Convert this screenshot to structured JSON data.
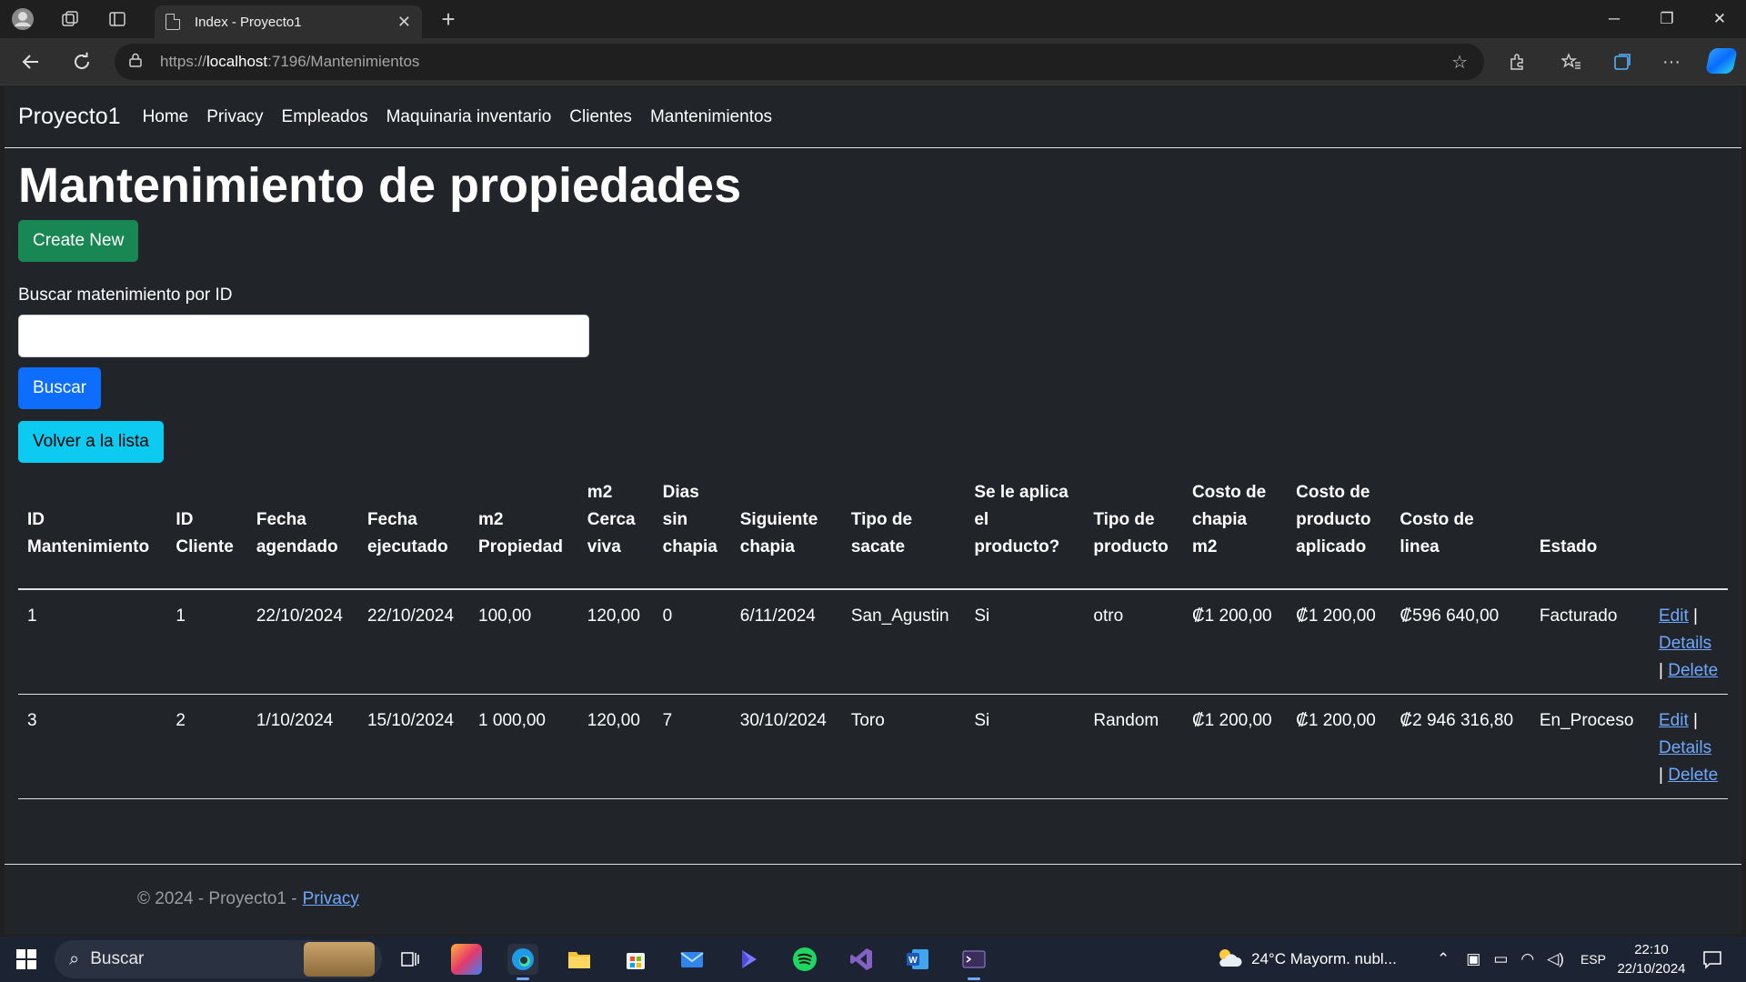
{
  "browser": {
    "tab_title": "Index - Proyecto1",
    "url_proto": "https://",
    "url_host": "localhost",
    "url_path": ":7196/Mantenimientos",
    "new_tab_label": "+"
  },
  "navbar": {
    "brand": "Proyecto1",
    "links": [
      "Home",
      "Privacy",
      "Empleados",
      "Maquinaria inventario",
      "Clientes",
      "Mantenimientos"
    ]
  },
  "main": {
    "title": "Mantenimiento de propiedades",
    "create_label": "Create New",
    "search_label": "Buscar matenimiento por ID",
    "search_value": "",
    "search_button": "Buscar",
    "back_button": "Volver a la lista"
  },
  "table": {
    "headers": [
      [
        "ID",
        "Mantenimiento"
      ],
      [
        "ID",
        "Cliente"
      ],
      [
        "Fecha",
        "agendado"
      ],
      [
        "Fecha",
        "ejecutado"
      ],
      [
        "m2",
        "Propiedad"
      ],
      [
        "m2",
        "Cerca",
        "viva"
      ],
      [
        "Dias",
        "sin",
        "chapia"
      ],
      [
        "Siguiente",
        "chapia"
      ],
      [
        "Tipo de",
        "sacate"
      ],
      [
        "Se le aplica",
        "el",
        "producto?"
      ],
      [
        "Tipo de",
        "producto"
      ],
      [
        "Costo de",
        "chapia",
        "m2"
      ],
      [
        "Costo de",
        "producto",
        "aplicado"
      ],
      [
        "Costo de",
        "linea"
      ],
      [
        "Estado"
      ],
      [
        ""
      ]
    ],
    "rows": [
      {
        "cells": [
          "1",
          "1",
          "22/10/2024",
          "22/10/2024",
          "100,00",
          "120,00",
          "0",
          "6/11/2024",
          "San_Agustin",
          "Si",
          "otro",
          "₡1 200,00",
          "₡1 200,00",
          "₡596 640,00",
          "Facturado"
        ],
        "edit": "Edit",
        "details": "Details",
        "delete": "Delete"
      },
      {
        "cells": [
          "3",
          "2",
          "1/10/2024",
          "15/10/2024",
          "1 000,00",
          "120,00",
          "7",
          "30/10/2024",
          "Toro",
          "Si",
          "Random",
          "₡1 200,00",
          "₡1 200,00",
          "₡2 946 316,80",
          "En_Proceso"
        ],
        "edit": "Edit",
        "details": "Details",
        "delete": "Delete"
      }
    ],
    "separator": "|"
  },
  "footer": {
    "text": "© 2024 - Proyecto1 -",
    "link": "Privacy"
  },
  "taskbar": {
    "search_placeholder": "Buscar",
    "weather": "24°C  Mayorm. nubl...",
    "language": "ESP",
    "time": "22:10",
    "date": "22/10/2024"
  },
  "colors": {
    "page_bg": "#212529",
    "success": "#198754",
    "primary": "#0d6efd",
    "info": "#0dcaf0",
    "link": "#6ea8fe"
  }
}
